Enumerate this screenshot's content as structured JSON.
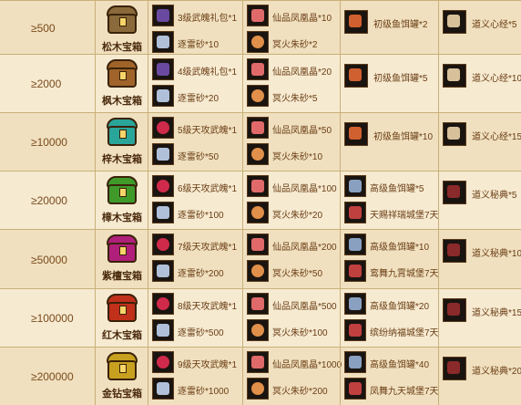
{
  "rows": [
    {
      "threshold": "≥500",
      "chest_name": "松木宝箱",
      "chest_color": "#8a6a3a",
      "c2a": "3级武魄礼包*1",
      "c2b": "逐雷砂*10",
      "c3a": "仙品凤凰晶*10",
      "c3b": "冥火朱砂*2",
      "c4a": "初级鱼饵罐*2",
      "c4b": "",
      "c5a": "道义心经*5",
      "c5b": ""
    },
    {
      "threshold": "≥2000",
      "chest_name": "枫木宝箱",
      "chest_color": "#a0642a",
      "c2a": "4级武魄礼包*1",
      "c2b": "逐雷砂*20",
      "c3a": "仙品凤凰晶*20",
      "c3b": "冥火朱砂*5",
      "c4a": "初级鱼饵罐*5",
      "c4b": "",
      "c5a": "道义心经*10",
      "c5b": ""
    },
    {
      "threshold": "≥10000",
      "chest_name": "梓木宝箱",
      "chest_color": "#2aa59a",
      "c2a": "5级天攻武魄*1",
      "c2b": "逐雷砂*50",
      "c3a": "仙品凤凰晶*50",
      "c3b": "冥火朱砂*10",
      "c4a": "初级鱼饵罐*10",
      "c4b": "",
      "c5a": "道义心经*15",
      "c5b": ""
    },
    {
      "threshold": "≥20000",
      "chest_name": "樟木宝箱",
      "chest_color": "#3f9a2a",
      "c2a": "6级天攻武魄*1",
      "c2b": "逐雷砂*100",
      "c3a": "仙品凤凰晶*100",
      "c3b": "冥火朱砂*20",
      "c4a": "高级鱼饵罐*5",
      "c4b": "天赐祥瑞城堡7天",
      "c5a": "道义秘典*5",
      "c5b": ""
    },
    {
      "threshold": "≥50000",
      "chest_name": "紫檀宝箱",
      "chest_color": "#b0207a",
      "c2a": "7级天攻武魄*1",
      "c2b": "逐雷砂*200",
      "c3a": "仙品凤凰晶*200",
      "c3b": "冥火朱砂*50",
      "c4a": "高级鱼饵罐*10",
      "c4b": "鸾舞九霄城堡7天",
      "c5a": "道义秘典*10",
      "c5b": ""
    },
    {
      "threshold": "≥100000",
      "chest_name": "红木宝箱",
      "chest_color": "#c0301a",
      "c2a": "8级天攻武魄*1",
      "c2b": "逐雷砂*500",
      "c3a": "仙品凤凰晶*500",
      "c3b": "冥火朱砂*100",
      "c4a": "高级鱼饵罐*20",
      "c4b": "缤纷纳福城堡7天",
      "c5a": "道义秘典*15",
      "c5b": ""
    },
    {
      "threshold": "≥200000",
      "chest_name": "金钻宝箱",
      "chest_color": "#c8a020",
      "c2a": "9级天攻武魄*1",
      "c2b": "逐雷砂*1000",
      "c3a": "仙品凤凰晶*1000",
      "c3b": "冥火朱砂*200",
      "c4a": "高级鱼饵罐*40",
      "c4b": "凤舞九天城堡7天",
      "c5a": "道义秘典*20",
      "c5b": ""
    }
  ],
  "icon_colors": {
    "gift": "#6a4aa0",
    "gem": "#d02a4a",
    "sand": "#b0c0d8",
    "crystal": "#e06a6a",
    "cinnabar": "#e0904a",
    "bait": "#d06030",
    "bait_adv": "#8aa0c0",
    "castle": "#c04040",
    "scroll": "#d8c09a",
    "book": "#8a2a2a"
  }
}
